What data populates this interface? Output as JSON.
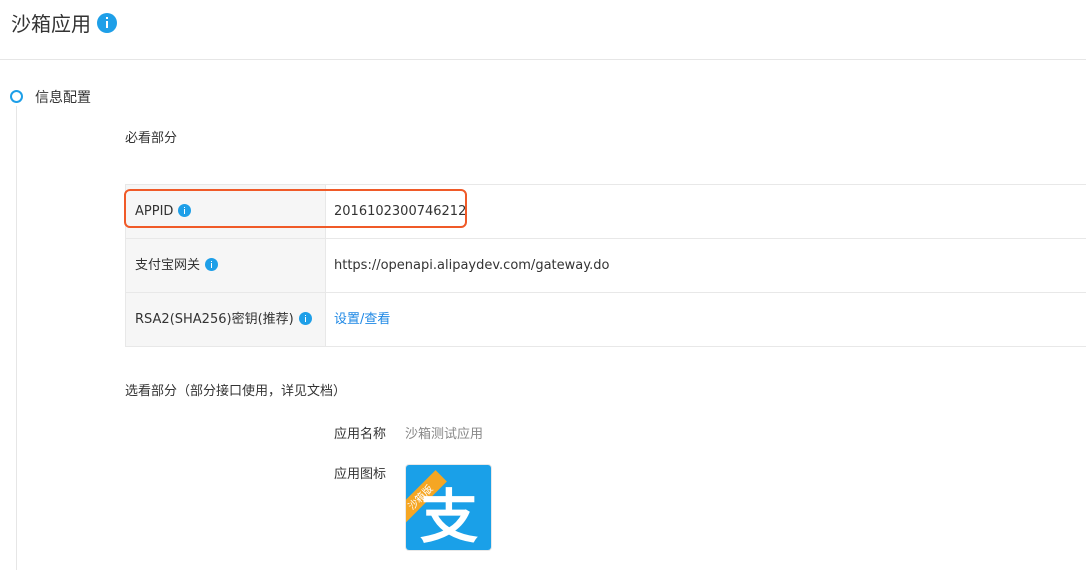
{
  "header": {
    "title": "沙箱应用"
  },
  "section": {
    "title": "信息配置"
  },
  "required": {
    "heading": "必看部分",
    "rows": [
      {
        "label": "APPID",
        "value": "2016102300746212"
      },
      {
        "label": "支付宝网关",
        "value": "https://openapi.alipaydev.com/gateway.do"
      },
      {
        "label": "RSA2(SHA256)密钥(推荐)",
        "value": "设置/查看"
      }
    ]
  },
  "optional": {
    "heading": "选看部分（部分接口使用，详见文档）",
    "app_name_label": "应用名称",
    "app_name_value": "沙箱测试应用",
    "app_icon_label": "应用图标",
    "app_icon_badge": "沙箱版",
    "app_icon_glyph": "支"
  },
  "colors": {
    "accent": "#1e9fe8",
    "link": "#1e88e5",
    "highlight": "#f05a28",
    "icon_bg": "#1aa0e8",
    "badge": "#f5a623"
  }
}
